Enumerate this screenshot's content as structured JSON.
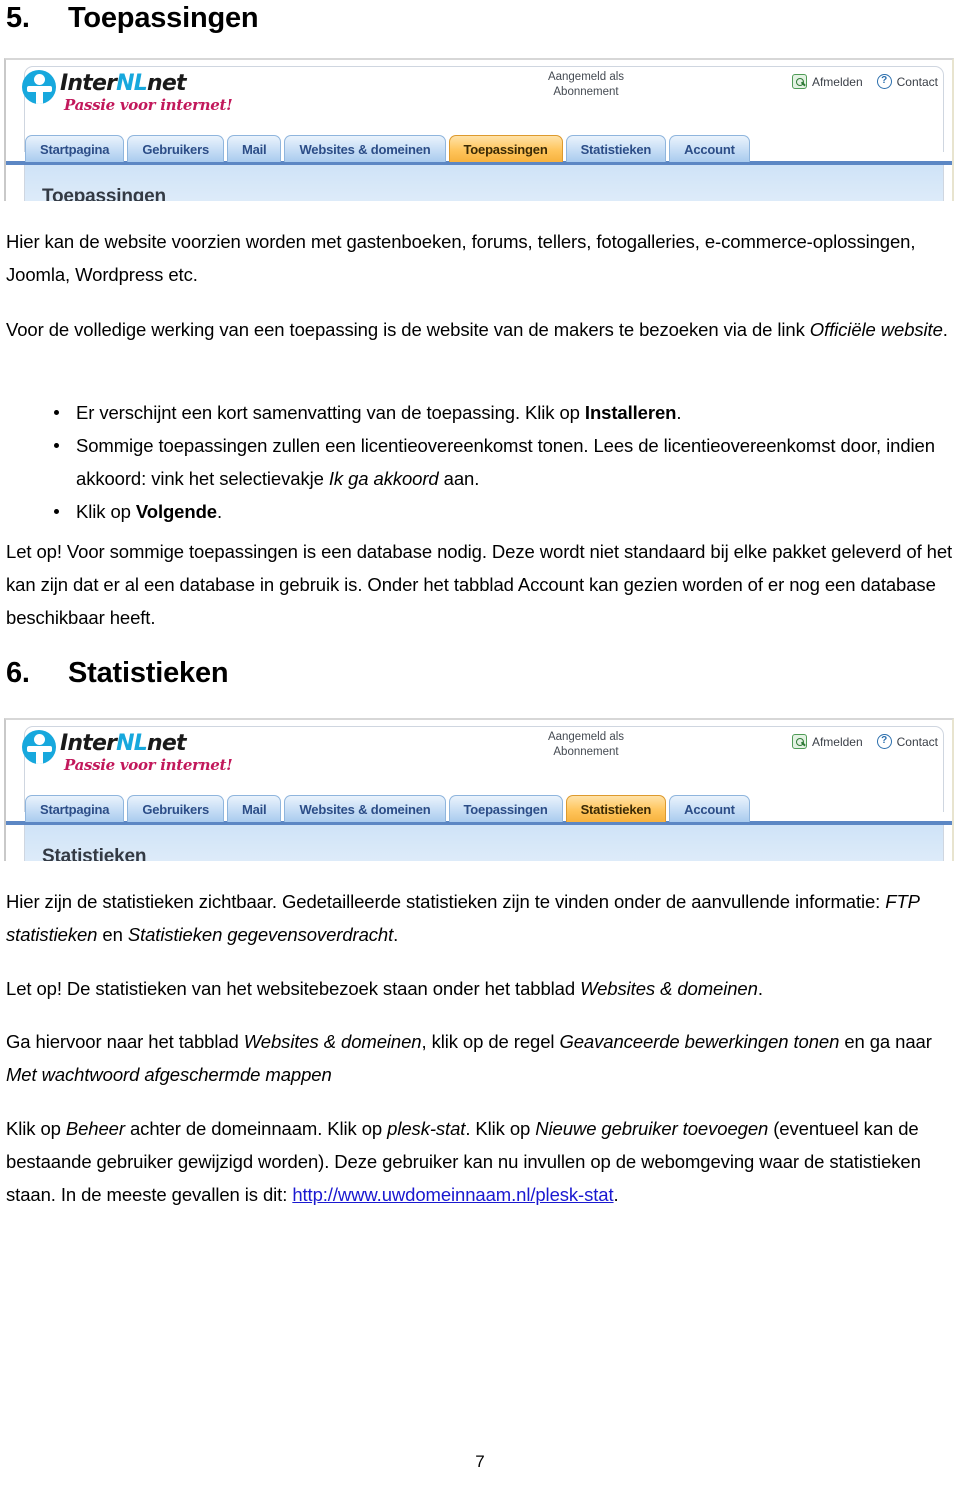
{
  "document": {
    "page_number": "7"
  },
  "section5": {
    "number": "5.",
    "title": "Toepassingen",
    "paragraph1": "Hier kan de website voorzien worden met gastenboeken, forums, tellers, fotogalleries, e-commerce-oplossingen, Joomla, Wordpress etc.",
    "paragraph2_a": "Voor de volledige werking van een toepassing is de website van de makers te bezoeken via de link ",
    "paragraph2_em": "Officiële website",
    "paragraph2_b": ".",
    "bullets": [
      {
        "text_a": "Er verschijnt een kort samenvatting van de toepassing. Klik op ",
        "bold": "Installeren",
        "text_b": "."
      },
      {
        "text_a": "Sommige toepassingen zullen een licentieovereenkomst tonen. Lees de licentieovereenkomst door, indien akkoord: vink het selectievakje ",
        "em": "Ik ga akkoord",
        "text_b": " aan."
      },
      {
        "text_a": "Klik op ",
        "bold": "Volgende",
        "text_b": "."
      }
    ],
    "note": "Let op! Voor sommige toepassingen is een database nodig. Deze wordt niet standaard bij elke pakket geleverd of het kan zijn dat er al een database in gebruik is. Onder het tabblad Account kan gezien worden of er nog een database beschikbaar heeft."
  },
  "section6": {
    "number": "6.",
    "title": "Statistieken",
    "paragraph1_a": "Hier zijn de statistieken zichtbaar. Gedetailleerde statistieken zijn te vinden onder de aanvullende informatie: ",
    "paragraph1_em1": "FTP statistieken",
    "paragraph1_b": " en ",
    "paragraph1_em2": "Statistieken gegevensoverdracht",
    "paragraph1_c": ".",
    "paragraph2_a": "Let op! De statistieken van het websitebezoek staan onder het tabblad ",
    "paragraph2_em": "Websites & domeinen",
    "paragraph2_b": ".",
    "paragraph3_a": "Ga hiervoor naar het tabblad ",
    "paragraph3_em1": "Websites & domeinen",
    "paragraph3_b": ", klik op de regel ",
    "paragraph3_em2": "Geavanceerde bewerkingen tonen",
    "paragraph3_c": " en ga naar ",
    "paragraph3_em3": "Met wachtwoord afgeschermde mappen",
    "paragraph4_a": "Klik op ",
    "paragraph4_em1": "Beheer",
    "paragraph4_b": " achter de domeinnaam. Klik op ",
    "paragraph4_em2": "plesk-stat",
    "paragraph4_c": ". Klik op ",
    "paragraph4_em3": "Nieuwe gebruiker toevoegen",
    "paragraph4_d": " (eventueel kan de bestaande gebruiker gewijzigd worden). Deze gebruiker kan nu invullen op de webomgeving waar de statistieken staan. In de meeste gevallen is dit: ",
    "paragraph4_link": "http://www.uwdomeinnaam.nl/plesk-stat",
    "paragraph4_e": "."
  },
  "screenshot_toepassingen": {
    "logo_text_a": "Inter",
    "logo_text_nl": "NL",
    "logo_text_b": "net",
    "logo_tagline": "Passie voor internet!",
    "account_line1": "Aangemeld als",
    "account_line2": "Abonnement",
    "logout_label": "Afmelden",
    "contact_label": "Contact",
    "help_glyph": "?",
    "tabs": [
      {
        "label": "Startpagina",
        "active": false
      },
      {
        "label": "Gebruikers",
        "active": false
      },
      {
        "label": "Mail",
        "active": false
      },
      {
        "label": "Websites & domeinen",
        "active": false
      },
      {
        "label": "Toepassingen",
        "active": true
      },
      {
        "label": "Statistieken",
        "active": false
      },
      {
        "label": "Account",
        "active": false
      }
    ],
    "content_title": "Toepassingen"
  },
  "screenshot_statistieken": {
    "logo_text_a": "Inter",
    "logo_text_nl": "NL",
    "logo_text_b": "net",
    "logo_tagline": "Passie voor internet!",
    "account_line1": "Aangemeld als",
    "account_line2": "Abonnement",
    "logout_label": "Afmelden",
    "contact_label": "Contact",
    "help_glyph": "?",
    "tabs": [
      {
        "label": "Startpagina",
        "active": false
      },
      {
        "label": "Gebruikers",
        "active": false
      },
      {
        "label": "Mail",
        "active": false
      },
      {
        "label": "Websites & domeinen",
        "active": false
      },
      {
        "label": "Toepassingen",
        "active": false
      },
      {
        "label": "Statistieken",
        "active": true
      },
      {
        "label": "Account",
        "active": false
      }
    ],
    "content_title": "Statistieken"
  }
}
